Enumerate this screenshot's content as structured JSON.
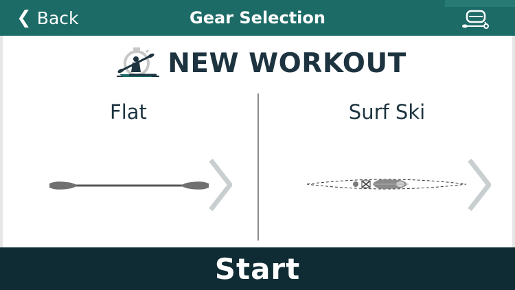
{
  "header": {
    "back_label": "Back",
    "title": "Gear Selection",
    "device_icon": "paddle-sensor-icon"
  },
  "main": {
    "heading": "NEW WORKOUT",
    "heading_icon": "kayaker-stopwatch-icon",
    "options": [
      {
        "label": "Flat",
        "icon": "paddle-icon"
      },
      {
        "label": "Surf Ski",
        "icon": "surf-ski-icon"
      }
    ]
  },
  "footer": {
    "start_label": "Start"
  },
  "colors": {
    "header_bg": "#1d6b67",
    "footer_bg": "#0f2b34",
    "heading_text": "#1d3440",
    "chevron": "#c9cfd0"
  }
}
